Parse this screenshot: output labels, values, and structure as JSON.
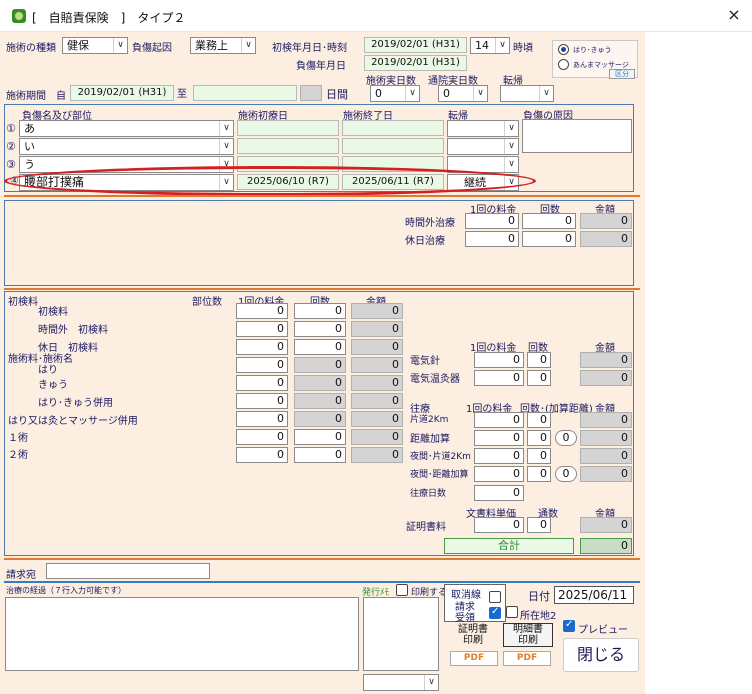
{
  "window": {
    "title": "[　自賠責保険　]　タイプ２",
    "close_icon": "×"
  },
  "treatment_type": {
    "label": "施術の種類",
    "value": "健保"
  },
  "injury_cause": {
    "label": "負傷起因",
    "value": "業務上"
  },
  "first_visit": {
    "label": "初検年月日･時刻",
    "date": "2019/02/01 (H31)",
    "hour": "14",
    "hour_suffix": "時頃"
  },
  "injury_date": {
    "label": "負傷年月日",
    "value": "2019/02/01 (H31)"
  },
  "mode": {
    "option1": "はり･きゅう",
    "option2": "あんまマッサージ",
    "button": "区分"
  },
  "period": {
    "label": "施術期間",
    "from_label": "自",
    "from": "2019/02/01 (H31)",
    "to_label": "至",
    "days_label": "日間"
  },
  "counts": {
    "actual_label": "施術実日数",
    "actual_value": "0",
    "hospital_label": "通院実日数",
    "hospital_value": "0",
    "outcome_label": "転帰"
  },
  "injury_table": {
    "headers": {
      "name": "負傷名及び部位",
      "start": "施術初療日",
      "end": "施術終了日",
      "outcome": "転帰",
      "cause": "負傷の原因"
    },
    "rows": [
      {
        "mark": "①",
        "name": "あ",
        "start": "",
        "end": "",
        "outcome": ""
      },
      {
        "mark": "②",
        "name": "い",
        "start": "",
        "end": "",
        "outcome": ""
      },
      {
        "mark": "③",
        "name": "う",
        "start": "",
        "end": "",
        "outcome": ""
      },
      {
        "mark": "④",
        "name": "腰部打撲痛",
        "start": "2025/06/10 (R7)",
        "end": "2025/06/11 (R7)",
        "outcome": "継続"
      }
    ]
  },
  "extra": {
    "per_label": "1回の料金",
    "times_label": "回数",
    "amount_label": "金額",
    "rows": [
      {
        "label": "時間外治療",
        "per": "0",
        "times": "0",
        "amount": "0"
      },
      {
        "label": "休日治療",
        "per": "0",
        "times": "0",
        "amount": "0"
      }
    ]
  },
  "exam": {
    "title": "初検料",
    "parts_label": "部位数",
    "per_label": "1回の料金",
    "times_label": "回数",
    "amount_label": "金額",
    "labels": {
      "l1": "初検料",
      "l2": "時間外　初検料",
      "l3": "休日　初検料",
      "l4": "施術料･施術名",
      "l5": "はり",
      "l6": "きゅう",
      "l7": "はり･きゅう併用",
      "l8": "はり又は灸とマッサージ併用",
      "l9": "１術",
      "l10": "２術"
    },
    "rows": [
      {
        "per": "0",
        "times": "0",
        "amount": "0"
      },
      {
        "per": "0",
        "times": "0",
        "amount": "0"
      },
      {
        "per": "0",
        "times": "0",
        "amount": "0"
      },
      {
        "per": "0",
        "times": "0",
        "amount": "0"
      },
      {
        "per": "0",
        "times": "0",
        "amount": "0"
      },
      {
        "per": "0",
        "times": "0",
        "amount": "0"
      },
      {
        "per": "0",
        "times": "0",
        "amount": "0"
      },
      {
        "per": "0",
        "times": "0",
        "amount": "0"
      },
      {
        "per": "0",
        "times": "0",
        "amount": "0"
      }
    ]
  },
  "electric": {
    "per_label": "1回の料金",
    "times_label": "回数",
    "amount_label": "金額",
    "rows": [
      {
        "label": "電気針",
        "per": "0",
        "times": "0",
        "amount": "0"
      },
      {
        "label": "電気温灸器",
        "per": "0",
        "times": "0",
        "amount": "0"
      }
    ]
  },
  "travel": {
    "title": "往療",
    "per_label": "1回の料金",
    "times_label": "回数･(加算距離)",
    "amount_label": "金額",
    "rows": [
      {
        "label": "片道2Km",
        "per": "0",
        "times": "0",
        "dist": "",
        "amount": "0"
      },
      {
        "label": "距離加算",
        "per": "0",
        "times": "0",
        "dist": "0",
        "amount": "0"
      },
      {
        "label": "夜間･片道2Km",
        "per": "0",
        "times": "0",
        "dist": "",
        "amount": "0"
      },
      {
        "label": "夜間･距離加算",
        "per": "0",
        "times": "0",
        "dist": "0",
        "amount": "0"
      }
    ],
    "days_label": "往療日数",
    "days_value": "0"
  },
  "cert": {
    "unit_label": "文書料単価",
    "count_label": "通数",
    "amount_label": "金額",
    "label": "証明書料",
    "unit": "0",
    "count": "0",
    "amount": "0"
  },
  "total": {
    "label": "合計",
    "value": "0"
  },
  "billing": {
    "label": "請求宛",
    "value": ""
  },
  "progress": {
    "label": "治療の経過（７行入力可能です）",
    "value": ""
  },
  "memo": {
    "label": "発行ﾒﾓ",
    "print_label": "印刷する"
  },
  "cancel_box": {
    "l1": "取消線",
    "l2": "請求",
    "l3": "受領"
  },
  "location": {
    "label": "所在地2"
  },
  "date": {
    "label": "日付",
    "value": "2025/06/11"
  },
  "buttons": {
    "cert_print": "証明書\n印刷",
    "detail_print": "明細書\n印刷",
    "pdf1": "PDF",
    "pdf2": "PDF",
    "preview": "プレビュー",
    "close": "閉じる"
  }
}
